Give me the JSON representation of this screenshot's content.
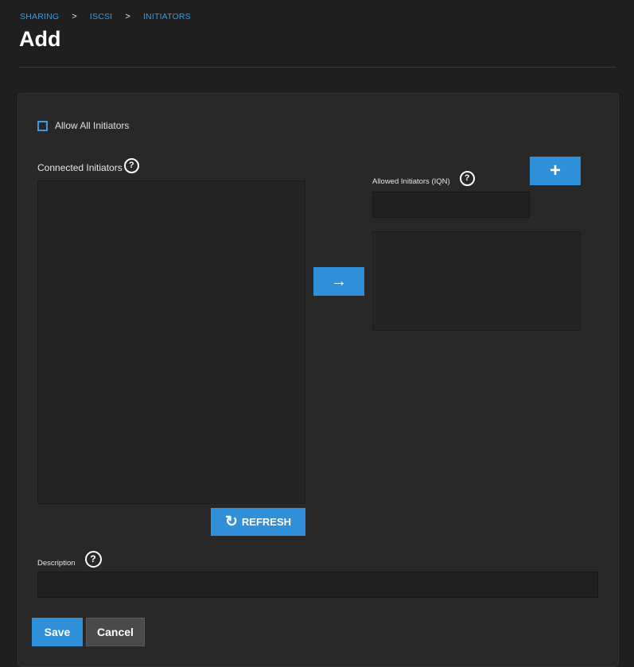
{
  "breadcrumb": {
    "items": [
      "SHARING",
      "ISCSI",
      "INITIATORS"
    ],
    "separator": ">"
  },
  "page": {
    "title": "Add"
  },
  "form": {
    "allow_all_label": "Allow All Initiators",
    "allow_all_checked": false,
    "connected_label": "Connected Initiators",
    "allowed_label": "Allowed Initiators (IQN)",
    "allowed_input_value": "",
    "description_label": "Description",
    "description_value": "",
    "help_glyph": "?"
  },
  "buttons": {
    "refresh_label": "REFRESH",
    "add_glyph": "+",
    "move_glyph": "→",
    "refresh_glyph": "↻",
    "save_label": "Save",
    "cancel_label": "Cancel"
  },
  "icons": {
    "help": "help-circle-icon",
    "add": "plus-icon",
    "move": "arrow-right-icon",
    "refresh": "refresh-icon"
  },
  "colors": {
    "accent": "#2f8fd9",
    "background": "#1f1f1f",
    "card": "#282828"
  }
}
